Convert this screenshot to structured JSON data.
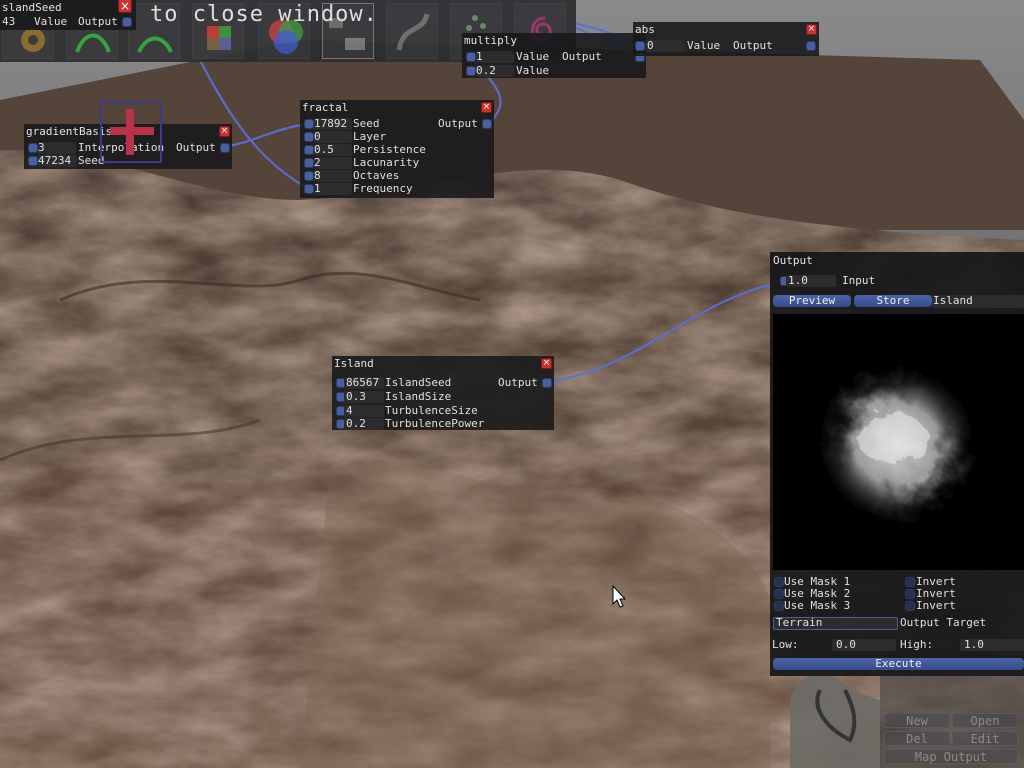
{
  "hint_text": "to close window.",
  "colors": {
    "wire": "#5a6fd0",
    "port": "#4a5f9e",
    "close": "#c83232",
    "button": "#3f55a0"
  },
  "toolbar": {
    "icons": [
      "gear-icon",
      "arc-up-icon",
      "arc-down-icon",
      "palette-grid-icon",
      "color-wheel-icon",
      "selected-blocks-icon",
      "curve-icon",
      "scatter-icon",
      "spiral-icon"
    ]
  },
  "nodes": {
    "islandSeed": {
      "title": "slandSeed",
      "value": "43",
      "label": "Value",
      "output": "Output"
    },
    "multiply": {
      "title": "multiply",
      "rows": [
        {
          "value": "1",
          "label": "Value"
        },
        {
          "value": "0.2",
          "label": "Value"
        }
      ],
      "output": "Output"
    },
    "abs": {
      "title": "abs",
      "value": "0",
      "label": "Value",
      "output": "Output"
    },
    "fractal": {
      "title": "fractal",
      "output": "Output",
      "rows": [
        {
          "value": "17892",
          "label": "Seed"
        },
        {
          "value": "0",
          "label": "Layer"
        },
        {
          "value": "0.5",
          "label": "Persistence"
        },
        {
          "value": "2",
          "label": "Lacunarity"
        },
        {
          "value": "8",
          "label": "Octaves"
        },
        {
          "value": "1",
          "label": "Frequency"
        }
      ]
    },
    "gradientBasis": {
      "title": "gradientBasis",
      "output": "Output",
      "rows": [
        {
          "value": "3",
          "label": "Interpolation"
        },
        {
          "value": "47234",
          "label": "Seed"
        }
      ]
    },
    "island": {
      "title": "Island",
      "output": "Output",
      "rows": [
        {
          "value": "86567",
          "label": "IslandSeed"
        },
        {
          "value": "0.3",
          "label": "IslandSize"
        },
        {
          "value": "4",
          "label": "TurbulenceSize"
        },
        {
          "value": "0.2",
          "label": "TurbulencePower"
        }
      ]
    }
  },
  "output_panel": {
    "title": "Output",
    "input_value": "1.0",
    "input_label": "Input",
    "preview_button": "Preview",
    "store_button": "Store",
    "store_name": "Island",
    "masks": [
      {
        "label": "Use Mask 1",
        "invert": "Invert"
      },
      {
        "label": "Use Mask 2",
        "invert": "Invert"
      },
      {
        "label": "Use Mask 3",
        "invert": "Invert"
      }
    ],
    "target_value": "Terrain",
    "target_label": "Output Target",
    "low_label": "Low:",
    "low_value": "0.0",
    "high_label": "High:",
    "high_value": "1.0",
    "execute_button": "Execute"
  },
  "bottom_buttons": {
    "new": "New",
    "open": "Open",
    "del": "Del",
    "edit": "Edit",
    "map_output": "Map Output"
  }
}
